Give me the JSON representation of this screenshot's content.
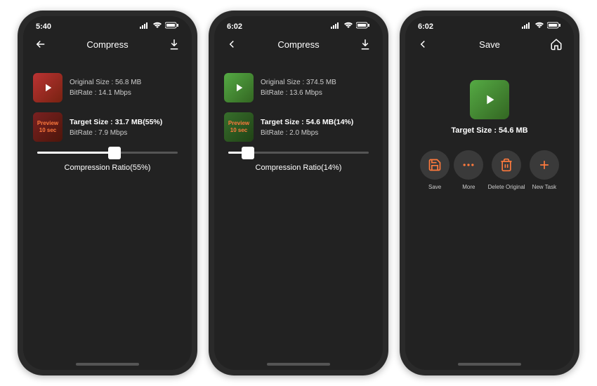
{
  "phones": [
    {
      "time": "5:40",
      "title": "Compress",
      "back": "arrow",
      "original": {
        "size": "Original Size : 56.8 MB",
        "bitrate": "BitRate : 14.1 Mbps"
      },
      "target": {
        "headline": "Target Size : 31.7 MB(55%)",
        "bitrate": "BitRate : 7.9 Mbps"
      },
      "preview": {
        "line1": "Preview",
        "line2": "10 sec"
      },
      "slider": {
        "percent": 55,
        "label": "Compression Ratio(55%)"
      },
      "thumbClass": "straw"
    },
    {
      "time": "6:02",
      "title": "Compress",
      "back": "chevron",
      "original": {
        "size": "Original Size : 374.5 MB",
        "bitrate": "BitRate : 13.6 Mbps"
      },
      "target": {
        "headline": "Target Size : 54.6 MB(14%)",
        "bitrate": "BitRate : 2.0 Mbps"
      },
      "preview": {
        "line1": "Preview",
        "line2": "10 sec"
      },
      "slider": {
        "percent": 14,
        "label": "Compression Ratio(14%)"
      },
      "thumbClass": ""
    }
  ],
  "save": {
    "time": "6:02",
    "title": "Save",
    "target": "Target Size : 54.6 MB",
    "actions": [
      {
        "name": "save",
        "label": "Save"
      },
      {
        "name": "more",
        "label": "More"
      },
      {
        "name": "delete",
        "label": "Delete Original"
      },
      {
        "name": "newtask",
        "label": "New Task"
      }
    ]
  }
}
